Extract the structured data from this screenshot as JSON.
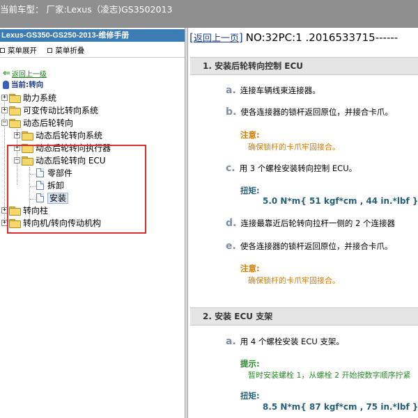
{
  "window": {
    "title": "当前车型：  厂家:Lexus（凌志)GS3502013"
  },
  "left_pane": {
    "book_title": "Lexus-GS350-GS250-2013-维修手册",
    "menu": {
      "expand_label": "菜单展开",
      "collapse_label": "菜单折叠"
    },
    "back_link": "返回上一级",
    "current_label": "当前:转向",
    "tree": {
      "n1": "助力系统",
      "n2": "可变传动比转向系统",
      "n3": "动态后轮转向",
      "n3_1": "动态后轮转向系统",
      "n3_2": "动态后轮转向执行器",
      "n3_3": "动态后轮转向 ECU",
      "n3_3_1": "零部件",
      "n3_3_2": "拆卸",
      "n3_3_3": "安装",
      "n4": "转向柱",
      "n5": "转向机/转向传动机构"
    }
  },
  "right_pane": {
    "back_link": "返回上一页",
    "doc_code": "NO:32PC:1 .2016533715------",
    "section1": {
      "title": "1. 安装后轮转向控制 ECU",
      "a_letter": "a.",
      "a_text": "连接车辆线束连接器。",
      "b_letter": "b.",
      "b_text": "使各连接器的锁杆返回原位，并接合卡爪。",
      "note1_title": "注意:",
      "note1_text": "确保锁杆的卡爪牢固接合。",
      "c_letter": "c.",
      "c_text": "用 3 个螺栓安装转向控制 ECU。",
      "torque_title": "扭矩:",
      "torque_value": "5.0 N*m{ 51 kgf*cm , 44 in.*lbf }",
      "d_letter": "d.",
      "d_text": "连接最靠近后轮转向拉杆一侧的 2 个连接器",
      "e_letter": "e.",
      "e_text": "使各连接器的锁杆返回原位，并接合卡爪。",
      "note2_title": "注意:",
      "note2_text": "确保锁杆的卡爪牢固接合。"
    },
    "section2": {
      "title": "2. 安装 ECU 支架",
      "a_letter": "a.",
      "a_text": "用 4 个螺栓安装 ECU 支架。",
      "hint_title": "提示:",
      "hint_text": "暂时安装螺栓 1，从螺栓 2 开始按数字顺序拧紧",
      "torque_title": "扭矩:",
      "torque_value": "8.5 N*m{ 87 kgf*cm , 75 in.*lbf }"
    }
  },
  "colors": {
    "title_bar": "#8f8f8f",
    "book_title_bg": "#3b7cb4",
    "highlight_box": "#dc2b2b",
    "note": "#d87a00",
    "hint": "#2a8a2a",
    "torque": "#25607a"
  }
}
